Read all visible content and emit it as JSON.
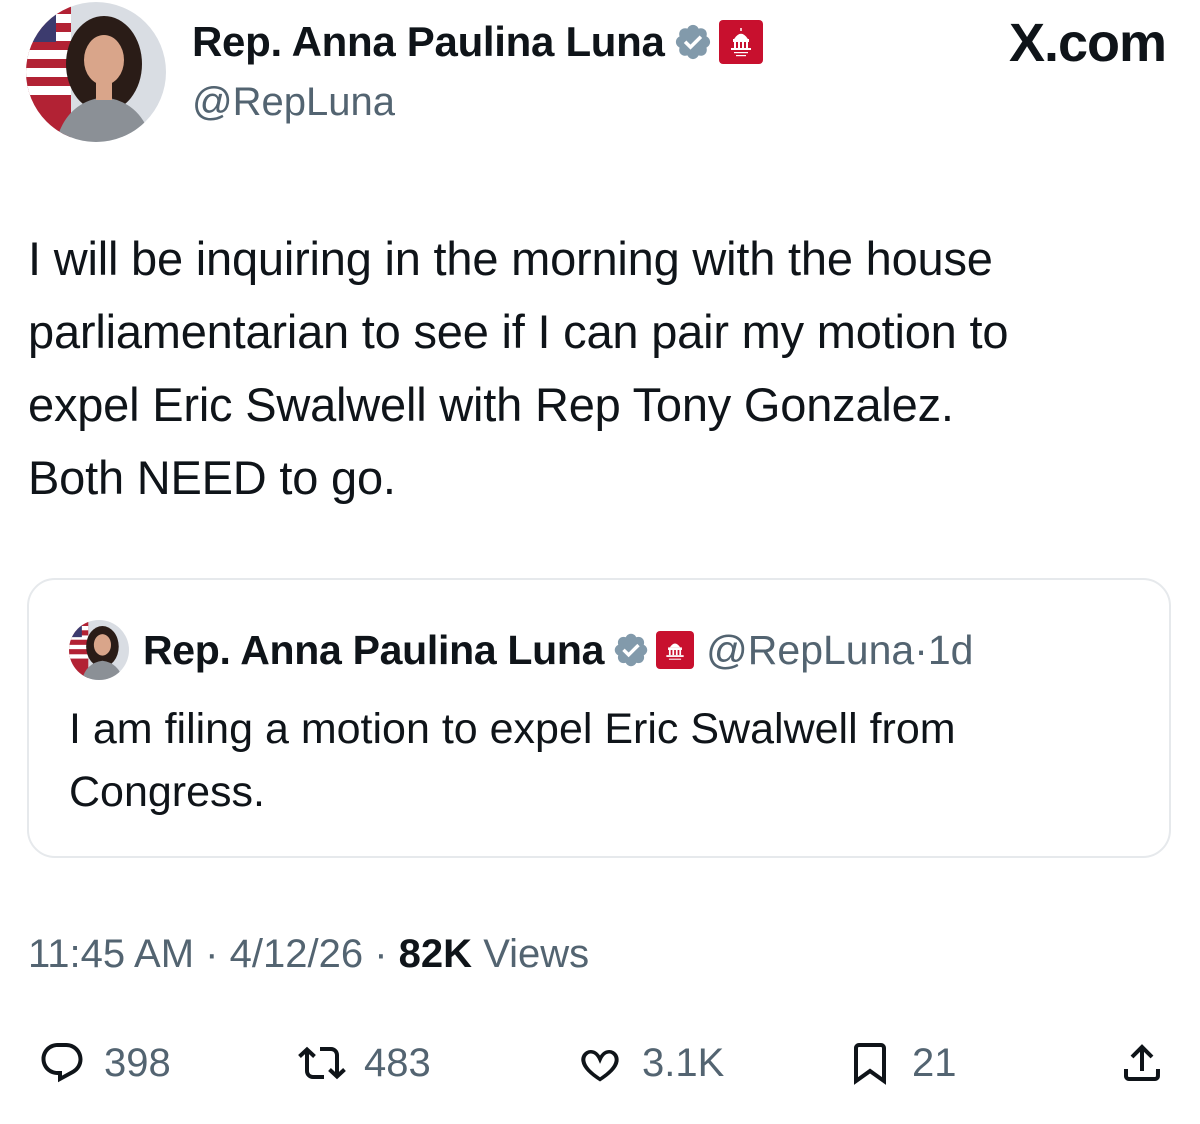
{
  "header": {
    "display_name": "Rep. Anna Paulina Luna",
    "handle": "@RepLuna",
    "verified_icon": "verified-badge-icon",
    "affiliation_icon": "house-gop-logo-icon",
    "site_label": "X.com"
  },
  "tweet": {
    "text_lines": [
      "I will be inquiring in the morning with the house",
      "parliamentarian to see if I can pair my motion to",
      "expel Eric Swalwell with Rep Tony Gonzalez.",
      "Both NEED to go."
    ]
  },
  "quoted": {
    "display_name": "Rep. Anna Paulina Luna",
    "handle": "@RepLuna",
    "separator": "·",
    "age": "1d",
    "text_lines": [
      "I am filing a motion to expel Eric Swalwell from",
      "Congress."
    ]
  },
  "meta": {
    "time": "11:45 AM",
    "date": "4/12/26",
    "separator": "·",
    "views_count": "82K",
    "views_label": "Views"
  },
  "actions": {
    "replies": "398",
    "reposts": "483",
    "likes": "3.1K",
    "bookmarks": "21"
  },
  "colors": {
    "text": "#0f1419",
    "secondary": "#536471",
    "verified": "#829aab",
    "gop_red": "#c8102e",
    "border": "#e6e9ec"
  }
}
